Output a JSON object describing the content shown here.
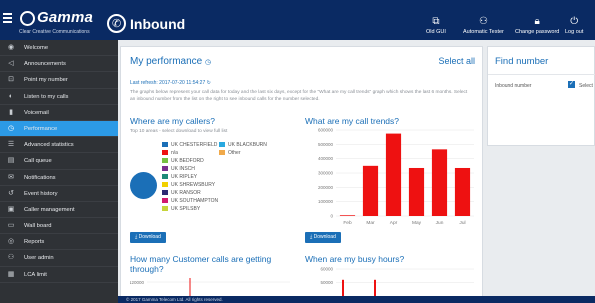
{
  "header": {
    "logo_text": "Gamma",
    "logo_tagline": "Clear Creative Communications",
    "page_title": "Inbound",
    "links": [
      {
        "label": "Old GUI",
        "icon": "external-link-icon"
      },
      {
        "label": "Automatic Tester",
        "icon": "user-icon"
      },
      {
        "label": "Change password",
        "icon": "lock-icon"
      },
      {
        "label": "Log out",
        "icon": "power-icon"
      }
    ]
  },
  "sidebar": {
    "items": [
      {
        "label": "Welcome",
        "icon": "eye-icon",
        "active": false
      },
      {
        "label": "Announcements",
        "icon": "megaphone-icon",
        "active": false
      },
      {
        "label": "Point my number",
        "icon": "phone-arrow-icon",
        "active": false
      },
      {
        "label": "Listen to my calls",
        "icon": "headphones-icon",
        "active": false
      },
      {
        "label": "Voicemail",
        "icon": "microphone-icon",
        "active": false
      },
      {
        "label": "Performance",
        "icon": "clock-icon",
        "active": true
      },
      {
        "label": "Advanced statistics",
        "icon": "bars-icon",
        "active": false
      },
      {
        "label": "Call queue",
        "icon": "queue-icon",
        "active": false
      },
      {
        "label": "Notifications",
        "icon": "mail-icon",
        "active": false
      },
      {
        "label": "Event history",
        "icon": "history-icon",
        "active": false
      },
      {
        "label": "Caller management",
        "icon": "briefcase-icon",
        "active": false
      },
      {
        "label": "Wall board",
        "icon": "monitor-icon",
        "active": false
      },
      {
        "label": "Reports",
        "icon": "report-icon",
        "active": false
      },
      {
        "label": "User admin",
        "icon": "user-icon",
        "active": false
      },
      {
        "label": "LCA limit",
        "icon": "limit-icon",
        "active": false
      }
    ]
  },
  "performance": {
    "title": "My performance",
    "select_all": "Select all",
    "last_refresh": "Last refresh: 2017-07-20 11:54:27",
    "description": "The graphs below represent your call data for today and the last six days, except for the \"What are my call trends\" graph which shows the last 6 months. Select an inbound number from the list on the right to see inbound calls for the number selected.",
    "callers": {
      "title": "Where are my callers?",
      "subtitle": "Top 10 areas - select download to view full list",
      "download_label": "Download"
    },
    "trends": {
      "title": "What are my call trends?",
      "download_label": "Download"
    },
    "customer_calls": {
      "title_line1": "How many Customer calls are getting",
      "title_line2": "through?"
    },
    "busy_hours": {
      "title": "When are my busy hours?"
    }
  },
  "colors": {
    "header_bg": "#0a2a63",
    "sidebar_bg": "#2f3236",
    "active_item": "#2c9ae6",
    "link_blue": "#1b6fb7",
    "bar_red": "#ee1111"
  },
  "find_number": {
    "title": "Find number",
    "inbound_label": "Inbound number",
    "select_label": "Select",
    "checked": true
  },
  "footer": {
    "text": "© 2017 Gamma Telecom Ltd. All rights reserved."
  },
  "chart_data": [
    {
      "type": "pie",
      "title": "Where are my callers?",
      "legend": [
        {
          "name": "UK CHESTERFIELD",
          "color": "#1b6fb7"
        },
        {
          "name": "UK BLACKBURN",
          "color": "#29a9e0"
        },
        {
          "name": "n/a",
          "color": "#ee1111"
        },
        {
          "name": "Other",
          "color": "#f0a94a"
        },
        {
          "name": "UK BEDFORD",
          "color": "#77c043"
        },
        {
          "name": "UK INSCH",
          "color": "#7a2f8f"
        },
        {
          "name": "UK RIPLEY",
          "color": "#1d8a78"
        },
        {
          "name": "UK SHREWSBURY",
          "color": "#f1d000"
        },
        {
          "name": "UK RANSOR",
          "color": "#2d2a73"
        },
        {
          "name": "UK SOUTHAMPTON",
          "color": "#d1186e"
        },
        {
          "name": "UK SPILSBY",
          "color": "#c6d43a"
        }
      ],
      "values": [
        100
      ]
    },
    {
      "type": "bar",
      "title": "What are my call trends?",
      "categories": [
        "Feb",
        "Mar",
        "Apr",
        "May",
        "Jun",
        "Jul"
      ],
      "values": [
        5000,
        350000,
        575000,
        335000,
        465000,
        335000
      ],
      "ylim": [
        0,
        600000
      ],
      "yticks": [
        0,
        100000,
        200000,
        300000,
        400000,
        500000,
        600000
      ],
      "color": "#ee1111"
    },
    {
      "type": "line",
      "title": "How many Customer calls are getting through?",
      "yticks": [
        100000,
        120000
      ],
      "values": [
        115000,
        115000
      ]
    },
    {
      "type": "bar",
      "title": "When are my busy hours?",
      "yticks": [
        50000,
        60000
      ],
      "ylim": [
        40000,
        60000
      ],
      "values": [
        52000,
        52000
      ]
    }
  ]
}
